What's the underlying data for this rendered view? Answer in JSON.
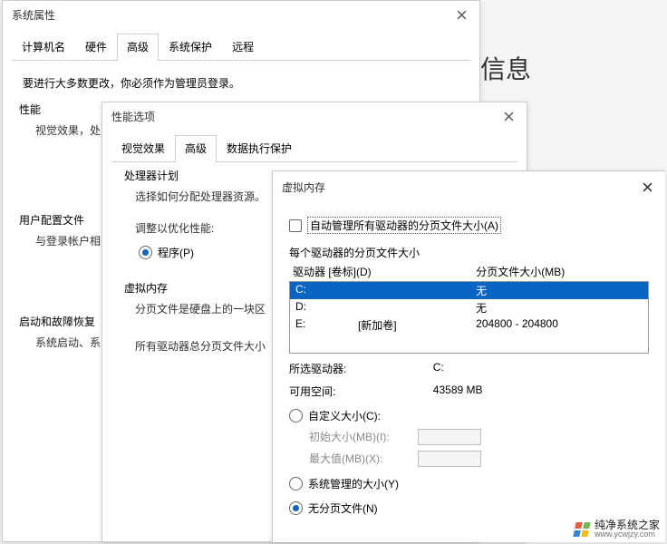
{
  "bg_info": "信息",
  "w1": {
    "title": "系统属性",
    "tabs": [
      "计算机名",
      "硬件",
      "高级",
      "系统保护",
      "远程"
    ],
    "active_tab": 2,
    "note": "要进行大多数更改，你必须作为管理员登录。",
    "perf": {
      "title": "性能",
      "desc": "视觉效果，处"
    },
    "profiles": {
      "title": "用户配置文件",
      "desc": "与登录帐户相"
    },
    "startup": {
      "title": "启动和故障恢复",
      "desc": "系统启动、系"
    }
  },
  "w2": {
    "title": "性能选项",
    "tabs": [
      "视觉效果",
      "高级",
      "数据执行保护"
    ],
    "active_tab": 1,
    "cpu": {
      "title": "处理器计划",
      "desc": "选择如何分配处理器资源。",
      "adjust": "调整以优化性能:",
      "radio": "程序(P)"
    },
    "vm": {
      "title": "虚拟内存",
      "desc": "分页文件是硬盘上的一块区",
      "total": "所有驱动器总分页文件大小"
    }
  },
  "w3": {
    "title": "虚拟内存",
    "auto": "自动管理所有驱动器的分页文件大小(A)",
    "per_drive": "每个驱动器的分页文件大小",
    "col_left": "驱动器 [卷标](D)",
    "col_right": "分页文件大小(MB)",
    "rows": [
      {
        "d": "C:",
        "label": "",
        "size": "无"
      },
      {
        "d": "D:",
        "label": "",
        "size": "无"
      },
      {
        "d": "E:",
        "label": "[新加卷]",
        "size": "204800 - 204800"
      }
    ],
    "selected_drive": {
      "k": "所选驱动器:",
      "v": "C:"
    },
    "free_space": {
      "k": "可用空间:",
      "v": "43589 MB"
    },
    "custom": "自定义大小(C):",
    "initial": "初始大小(MB)(I):",
    "maximum": "最大值(MB)(X):",
    "sys_managed": "系统管理的大小(Y)",
    "no_page": "无分页文件(N)",
    "radio_selected": "no_page"
  },
  "watermark": {
    "brand": "纯净系统之家",
    "url": "www.ycwjzy.com"
  }
}
